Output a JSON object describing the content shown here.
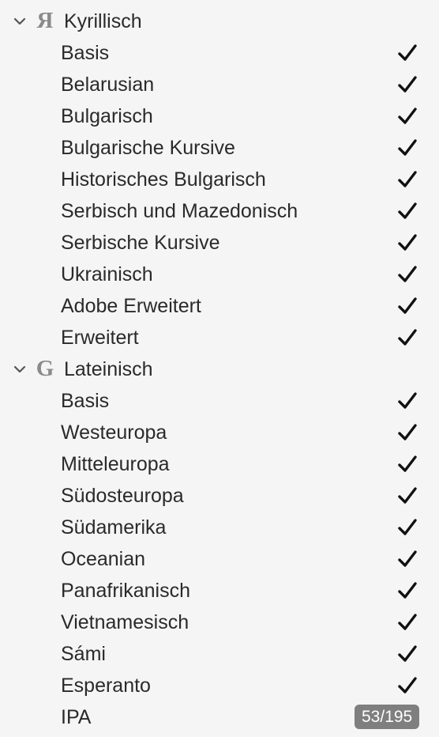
{
  "groups": [
    {
      "label": "Kyrillisch",
      "glyph": "Я",
      "expanded": true,
      "items": [
        {
          "label": "Basis",
          "checked": true
        },
        {
          "label": "Belarusian",
          "checked": true
        },
        {
          "label": "Bulgarisch",
          "checked": true
        },
        {
          "label": "Bulgarische Kursive",
          "checked": true
        },
        {
          "label": "Historisches Bulgarisch",
          "checked": true
        },
        {
          "label": "Serbisch und Mazedonisch",
          "checked": true
        },
        {
          "label": "Serbische Kursive",
          "checked": true
        },
        {
          "label": "Ukrainisch",
          "checked": true
        },
        {
          "label": "Adobe Erweitert",
          "checked": true
        },
        {
          "label": "Erweitert",
          "checked": true
        }
      ]
    },
    {
      "label": "Lateinisch",
      "glyph": "G",
      "expanded": true,
      "items": [
        {
          "label": "Basis",
          "checked": true
        },
        {
          "label": "Westeuropa",
          "checked": true
        },
        {
          "label": "Mitteleuropa",
          "checked": true
        },
        {
          "label": "Südosteuropa",
          "checked": true
        },
        {
          "label": "Südamerika",
          "checked": true
        },
        {
          "label": "Oceanian",
          "checked": true
        },
        {
          "label": "Panafrikanisch",
          "checked": true
        },
        {
          "label": "Vietnamesisch",
          "checked": true
        },
        {
          "label": "Sámi",
          "checked": true
        },
        {
          "label": "Esperanto",
          "checked": true
        },
        {
          "label": "IPA",
          "checked": false,
          "badge": "53/195"
        }
      ]
    }
  ],
  "icons": {
    "chevron": "chevron-down-icon",
    "check": "checkmark-icon"
  },
  "colors": {
    "background": "#f5f5f5",
    "text": "#2a2a2a",
    "glyph": "#8a8a8a",
    "badge_bg": "#7f7f7f",
    "badge_text": "#ffffff",
    "check": "#111111"
  }
}
